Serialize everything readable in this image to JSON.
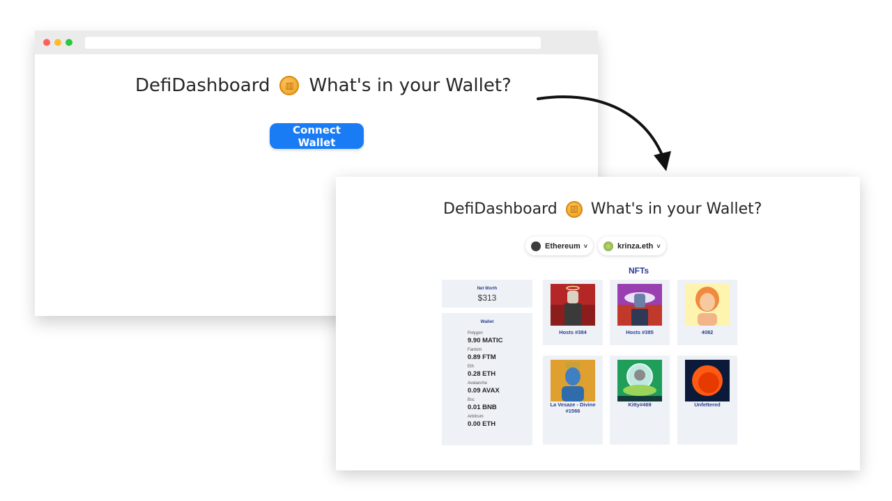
{
  "app_title": "DefiDashboard",
  "tagline": "What's in your Wallet?",
  "connect_label": "Connect Wallet",
  "dashboard": {
    "chain": "Ethereum",
    "account": "krinza.eth",
    "nfts_title": "NFTs",
    "net_worth_label": "Net Worth",
    "net_worth_value": "$313",
    "wallet_label": "Wallet",
    "balances": [
      {
        "network": "Polygon",
        "amount": "9.90 MATIC"
      },
      {
        "network": "Fantom",
        "amount": "0.89 FTM"
      },
      {
        "network": "Eth",
        "amount": "0.28 ETH"
      },
      {
        "network": "Avalanche",
        "amount": "0.09 AVAX"
      },
      {
        "network": "Bsc",
        "amount": "0.01 BNB"
      },
      {
        "network": "Arbitrum",
        "amount": "0.00 ETH"
      }
    ],
    "nfts": [
      {
        "name": "Hosts #384"
      },
      {
        "name": "Hosts #385"
      },
      {
        "name": "4082"
      },
      {
        "name": "La Vesaze - Divine #1566"
      },
      {
        "name": "Kitty#469"
      },
      {
        "name": "Unfettered"
      }
    ]
  },
  "colors": {
    "accent": "#1a7cf5",
    "nft_label": "#2a3f8f",
    "card_bg": "#eef1f6"
  }
}
